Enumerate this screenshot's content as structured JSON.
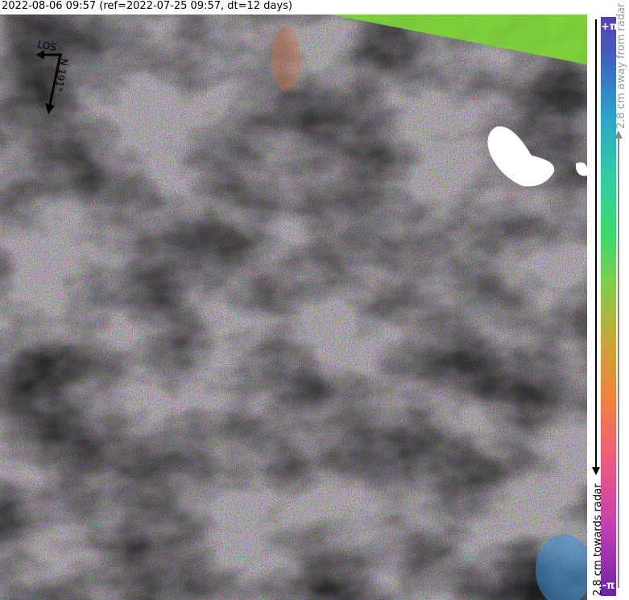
{
  "title": "2022-08-06 09:57 (ref=2022-07-25 09:57, dt=12 days)",
  "compass": {
    "los_label": "LOS",
    "north_label": "N 191°"
  },
  "colorbar": {
    "top_label": "+π",
    "bottom_label": "-π",
    "away_label": "2.8 cm away from radar",
    "towards_label": "2.8 cm towards radar",
    "colors": [
      "#6a22a8",
      "#c43fb0",
      "#f05c7a",
      "#f2823a",
      "#c9a63a",
      "#7fcf4a",
      "#3ed86a",
      "#2fcfa0",
      "#2aa9c8",
      "#3b67c4",
      "#5a3fb0"
    ]
  },
  "map": {
    "no_data_color": "#7fd83a",
    "masked_color": "#ffffff"
  }
}
